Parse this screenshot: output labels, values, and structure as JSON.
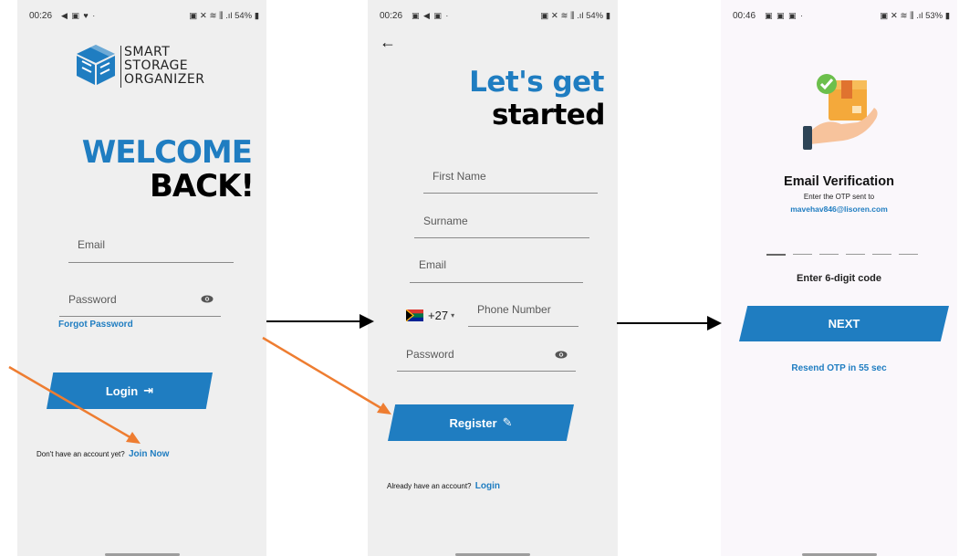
{
  "screens": {
    "login": {
      "status_time": "00:26",
      "status_right": "54%",
      "logo_lines": [
        "SMART",
        "STORAGE",
        "ORGANIZER"
      ],
      "welcome_line1": "WELCOME",
      "welcome_line2": "BACK!",
      "email_placeholder": "Email",
      "password_placeholder": "Password",
      "forgot_password": "Forgot Password",
      "login_button": "Login",
      "no_account_text": "Don't have an account yet?",
      "join_now": "Join Now"
    },
    "register": {
      "status_time": "00:26",
      "status_right": "54%",
      "heading_line1": "Let's get",
      "heading_line2": "started",
      "first_name_placeholder": "First Name",
      "surname_placeholder": "Surname",
      "email_placeholder": "Email",
      "country_code": "+27",
      "phone_placeholder": "Phone Number",
      "password_placeholder": "Password",
      "register_button": "Register",
      "have_account_text": "Already have an account?",
      "login_link": "Login"
    },
    "verify": {
      "status_time": "00:46",
      "status_right": "53%",
      "title": "Email Verification",
      "subtitle": "Enter the OTP sent to",
      "email": "mavehav846@lisoren.com",
      "code_hint": "Enter 6-digit code",
      "next_button": "NEXT",
      "resend": "Resend OTP in 55 sec"
    }
  },
  "colors": {
    "brand_blue": "#1f7dc1",
    "arrow_orange": "#ee7d31"
  }
}
